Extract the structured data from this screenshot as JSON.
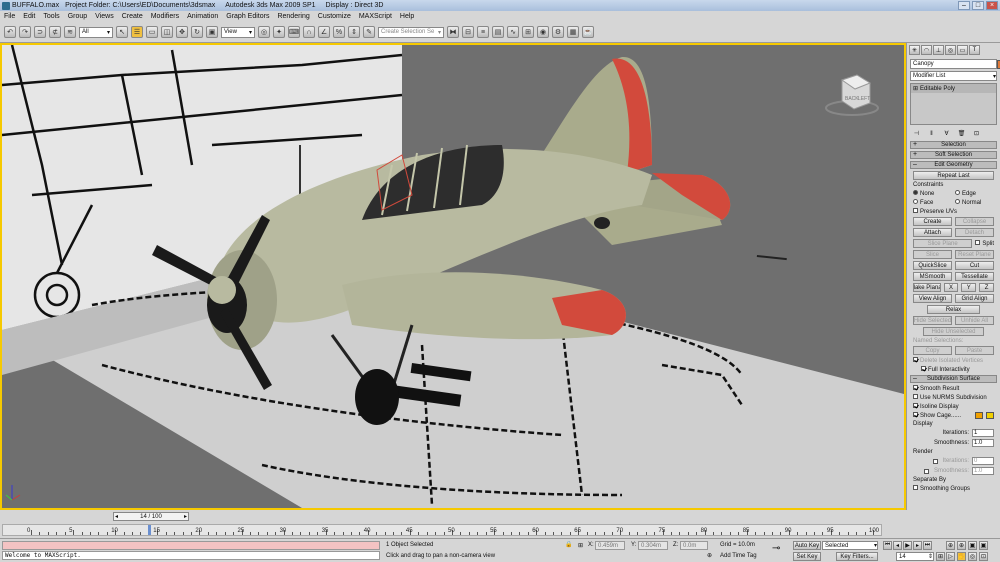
{
  "titlebar": {
    "file": "BUFFALO.max",
    "project": "Project Folder: C:\\Users\\ED\\Documents\\3dsmax",
    "app": "Autodesk 3ds Max  2009 SP1",
    "display": "Display : Direct 3D"
  },
  "menu": [
    "File",
    "Edit",
    "Tools",
    "Group",
    "Views",
    "Create",
    "Modifiers",
    "Animation",
    "Graph Editors",
    "Rendering",
    "Customize",
    "MAXScript",
    "Help"
  ],
  "toolbar": {
    "filter_value": "All",
    "refcoord_value": "View",
    "selection_set_placeholder": "Create Selection Se"
  },
  "viewcube": {
    "faces": [
      "BACK",
      "LEFT"
    ]
  },
  "command_panel": {
    "object_name": "Canopy",
    "object_color": "#e07a3a",
    "modifier_list": "Modifier List",
    "stack_item": "Editable Poly",
    "rollouts": {
      "selection": "Selection",
      "soft_selection": "Soft Selection",
      "edit_geometry": "Edit Geometry",
      "subdivision_surface": "Subdivision Surface"
    },
    "edit_geometry": {
      "repeat_last": "Repeat Last",
      "constraints_label": "Constraints",
      "constraints": [
        "None",
        "Edge",
        "Face",
        "Normal"
      ],
      "constraint_selected": "None",
      "preserve_uvs": "Preserve UVs",
      "create": "Create",
      "collapse": "Collapse",
      "attach": "Attach",
      "detach": "Detach",
      "slice_plane": "Slice Plane",
      "split": "Split",
      "slice": "Slice",
      "reset_plane": "Reset Plane",
      "quickslice": "QuickSlice",
      "cut": "Cut",
      "msmooth": "MSmooth",
      "tessellate": "Tessellate",
      "make_planar": "Make Planar",
      "axes": [
        "X",
        "Y",
        "Z"
      ],
      "view_align": "View Align",
      "grid_align": "Grid Align",
      "relax": "Relax",
      "hide_selected": "Hide Selected",
      "unhide_all": "Unhide All",
      "hide_unselected": "Hide Unselected",
      "named_selections": "Named Selections:",
      "copy": "Copy",
      "paste": "Paste",
      "delete_isolated": "Delete Isolated Vertices",
      "full_interactivity": "Full Interactivity"
    },
    "subdivision": {
      "smooth_result": "Smooth Result",
      "use_nurms": "Use NURMS Subdivision",
      "isoline_display": "Isoline Display",
      "show_cage": "Show Cage......",
      "cage_colors": [
        "#f0a000",
        "#f0d000"
      ],
      "display_label": "Display",
      "iterations_label": "Iterations:",
      "iterations_display": "1",
      "smoothness_label": "Smoothness:",
      "smoothness_display": "1.0",
      "render_label": "Render",
      "iterations_render": "0",
      "smoothness_render": "1.0",
      "separate_by": "Separate By",
      "smoothing_groups": "Smoothing Groups"
    }
  },
  "timeline": {
    "slider_label": "14 / 100",
    "ticks": [
      "0",
      "5",
      "10",
      "15",
      "20",
      "25",
      "30",
      "35",
      "40",
      "45",
      "50",
      "55",
      "60",
      "65",
      "70",
      "75",
      "80",
      "85",
      "90",
      "95",
      "100"
    ],
    "current_frame": 14,
    "total_frames": 100
  },
  "status": {
    "maxscript_output": "Welcome to MAXScript.",
    "selected": "1 Object Selected",
    "prompt": "Click and drag to pan a non-camera view",
    "x_label": "X:",
    "x_value": "0.459m",
    "y_label": "Y:",
    "y_value": "0.304m",
    "z_label": "Z:",
    "z_value": "0.0m",
    "grid": "Grid = 10.0m",
    "add_time_tag": "Add Time Tag",
    "auto_key": "Auto Key",
    "auto_key_value": "Selected",
    "set_key": "Set Key",
    "key_filters": "Key Filters...",
    "frame_field": "14"
  }
}
